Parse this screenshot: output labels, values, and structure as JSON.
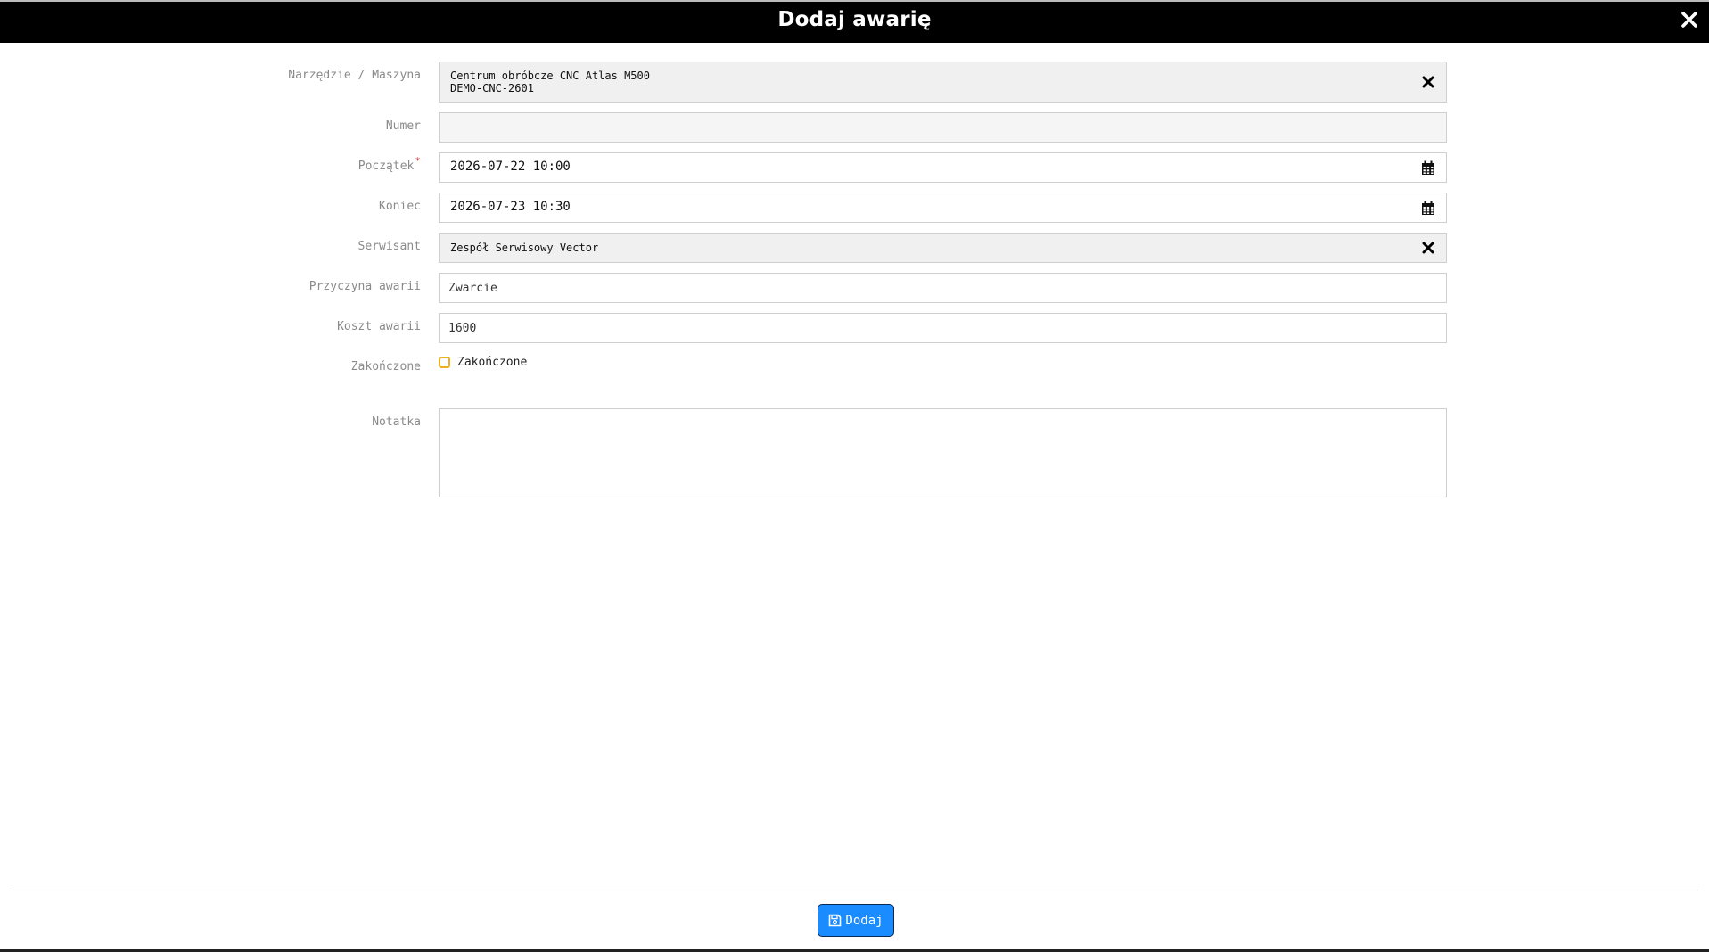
{
  "dialog": {
    "title": "Dodaj awarię"
  },
  "form": {
    "machine": {
      "label": "Narzędzie / Maszyna",
      "name": "Centrum obróbcze CNC Atlas M500",
      "code": "DEMO-CNC-2601"
    },
    "number": {
      "label": "Numer",
      "value": ""
    },
    "start": {
      "label": "Początek",
      "required_mark": "*",
      "value": "2026-07-22 10:00"
    },
    "end": {
      "label": "Koniec",
      "value": "2026-07-23 10:30"
    },
    "technician": {
      "label": "Serwisant",
      "value": "Zespół Serwisowy Vector"
    },
    "cause": {
      "label": "Przyczyna awarii",
      "value": "Zwarcie"
    },
    "cost": {
      "label": "Koszt awarii",
      "value": "1600"
    },
    "completed": {
      "label": "Zakończone",
      "checkbox_label": "Zakończone",
      "checked": false
    },
    "note": {
      "label": "Notatka",
      "value": ""
    }
  },
  "footer": {
    "submit_label": "Dodaj"
  },
  "colors": {
    "header_bg": "#000000",
    "primary_button": "#1a8cff",
    "checkbox_border": "#f0ad1e",
    "required_star": "#d9534f"
  }
}
